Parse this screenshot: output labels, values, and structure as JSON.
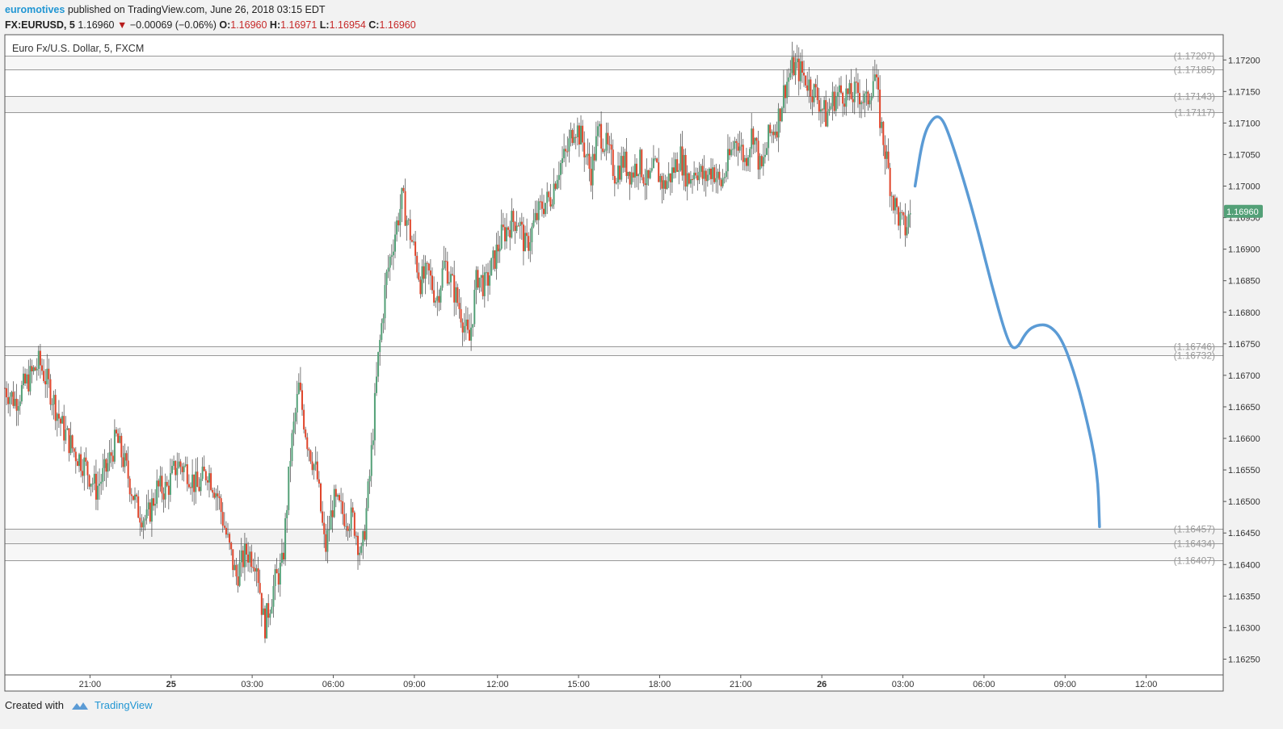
{
  "header": {
    "author": "euromotives",
    "published_text": "published on TradingView.com, June 26, 2018 03:15 EDT",
    "symbol": "FX:EURUSD, 5",
    "last_price": "1.16960",
    "change": "−0.00069 (−0.06%)",
    "o_label": "O:",
    "o_value": "1.16960",
    "h_label": "H:",
    "h_value": "1.16971",
    "l_label": "L:",
    "l_value": "1.16954",
    "c_label": "C:",
    "c_value": "1.16960"
  },
  "footer": {
    "created_with": "Created with",
    "brand": "TradingView"
  },
  "colors": {
    "up": "#53a077",
    "down": "#e0452b",
    "projection": "#5b9bd5",
    "price_tag": "#53a077",
    "level": "#999999"
  },
  "chart_data": {
    "type": "candlestick",
    "title": "Euro Fx/U.S. Dollar, 5, FXCM",
    "ylim": [
      1.16225,
      1.1724
    ],
    "y_ticks": [
      "1.17200",
      "1.17150",
      "1.17100",
      "1.17050",
      "1.17000",
      "1.16950",
      "1.16900",
      "1.16850",
      "1.16800",
      "1.16750",
      "1.16700",
      "1.16650",
      "1.16600",
      "1.16550",
      "1.16500",
      "1.16450",
      "1.16400",
      "1.16350",
      "1.16300",
      "1.16250"
    ],
    "x_ticks": [
      {
        "label": "21:00",
        "t": 11.3
      },
      {
        "label": "25",
        "t": 15.3
      },
      {
        "label": "03:00",
        "t": 19.3
      },
      {
        "label": "06:00",
        "t": 23.3
      },
      {
        "label": "09:00",
        "t": 27.3
      },
      {
        "label": "12:00",
        "t": 31.4
      },
      {
        "label": "15:00",
        "t": 35.4
      },
      {
        "label": "18:00",
        "t": 39.4
      },
      {
        "label": "21:00",
        "t": 43.4
      },
      {
        "label": "26",
        "t": 47.4
      },
      {
        "label": "03:00",
        "t": 51.4
      },
      {
        "label": "06:00",
        "t": 55.4
      },
      {
        "label": "09:00",
        "t": 59.4
      },
      {
        "label": "12:00",
        "t": 63.4
      }
    ],
    "x_range_hours": [
      7.1,
      67.2
    ],
    "last_price_tag": "1.16960",
    "levels": [
      {
        "label": "(1.17207)",
        "value": 1.17207
      },
      {
        "label": "(1.17185)",
        "value": 1.17185
      },
      {
        "label": "(1.17143)",
        "value": 1.17143
      },
      {
        "label": "(1.17117)",
        "value": 1.17117
      },
      {
        "label": "(1.16746)",
        "value": 1.16746
      },
      {
        "label": "(1.16732)",
        "value": 1.16732
      },
      {
        "label": "(1.16457)",
        "value": 1.16457
      },
      {
        "label": "(1.16434)",
        "value": 1.16434
      },
      {
        "label": "(1.16407)",
        "value": 1.16407
      }
    ],
    "price_path": [
      [
        7.1,
        1.1668
      ],
      [
        7.6,
        1.1666
      ],
      [
        8.2,
        1.1669
      ],
      [
        8.8,
        1.1672
      ],
      [
        9.3,
        1.1668
      ],
      [
        9.9,
        1.1662
      ],
      [
        10.5,
        1.1658
      ],
      [
        11.0,
        1.1656
      ],
      [
        11.6,
        1.1652
      ],
      [
        12.1,
        1.1655
      ],
      [
        12.6,
        1.166
      ],
      [
        13.1,
        1.1655
      ],
      [
        13.6,
        1.1649
      ],
      [
        14.1,
        1.1647
      ],
      [
        14.6,
        1.1652
      ],
      [
        15.1,
        1.1652
      ],
      [
        15.6,
        1.1656
      ],
      [
        16.1,
        1.1655
      ],
      [
        16.6,
        1.1652
      ],
      [
        17.1,
        1.1655
      ],
      [
        17.6,
        1.1651
      ],
      [
        18.0,
        1.1645
      ],
      [
        18.5,
        1.1638
      ],
      [
        19.0,
        1.1642
      ],
      [
        19.5,
        1.1641
      ],
      [
        19.9,
        1.163
      ],
      [
        20.4,
        1.1637
      ],
      [
        20.8,
        1.164
      ],
      [
        21.2,
        1.1658
      ],
      [
        21.6,
        1.1668
      ],
      [
        22.0,
        1.166
      ],
      [
        22.5,
        1.1654
      ],
      [
        22.9,
        1.1642
      ],
      [
        23.3,
        1.165
      ],
      [
        23.8,
        1.1648
      ],
      [
        24.3,
        1.1647
      ],
      [
        24.7,
        1.1641
      ],
      [
        25.1,
        1.1654
      ],
      [
        25.5,
        1.1672
      ],
      [
        25.9,
        1.1685
      ],
      [
        26.3,
        1.1692
      ],
      [
        26.7,
        1.1698
      ],
      [
        27.2,
        1.1691
      ],
      [
        27.6,
        1.1685
      ],
      [
        28.0,
        1.1686
      ],
      [
        28.4,
        1.1682
      ],
      [
        28.8,
        1.1688
      ],
      [
        29.2,
        1.1684
      ],
      [
        29.6,
        1.168
      ],
      [
        30.0,
        1.1675
      ],
      [
        30.4,
        1.1686
      ],
      [
        30.8,
        1.1684
      ],
      [
        31.2,
        1.1688
      ],
      [
        31.6,
        1.1692
      ],
      [
        32.0,
        1.1694
      ],
      [
        32.4,
        1.1695
      ],
      [
        32.8,
        1.169
      ],
      [
        33.2,
        1.1694
      ],
      [
        33.6,
        1.1697
      ],
      [
        34.0,
        1.1698
      ],
      [
        34.4,
        1.1703
      ],
      [
        34.8,
        1.1705
      ],
      [
        35.2,
        1.171
      ],
      [
        35.6,
        1.1707
      ],
      [
        36.0,
        1.1702
      ],
      [
        36.4,
        1.1709
      ],
      [
        36.8,
        1.1706
      ],
      [
        37.2,
        1.1702
      ],
      [
        37.6,
        1.1704
      ],
      [
        38.0,
        1.1702
      ],
      [
        38.4,
        1.1704
      ],
      [
        38.8,
        1.17
      ],
      [
        39.2,
        1.1703
      ],
      [
        39.6,
        1.17
      ],
      [
        40.0,
        1.1702
      ],
      [
        40.4,
        1.1705
      ],
      [
        40.8,
        1.1701
      ],
      [
        41.2,
        1.1703
      ],
      [
        41.6,
        1.1701
      ],
      [
        42.0,
        1.1703
      ],
      [
        42.4,
        1.17
      ],
      [
        42.8,
        1.1704
      ],
      [
        43.2,
        1.1708
      ],
      [
        43.6,
        1.1704
      ],
      [
        44.0,
        1.1709
      ],
      [
        44.4,
        1.1702
      ],
      [
        44.8,
        1.1708
      ],
      [
        45.2,
        1.171
      ],
      [
        45.6,
        1.1716
      ],
      [
        46.0,
        1.1719
      ],
      [
        46.4,
        1.1718
      ],
      [
        46.8,
        1.1716
      ],
      [
        47.2,
        1.1714
      ],
      [
        47.6,
        1.1711
      ],
      [
        48.0,
        1.1714
      ],
      [
        48.4,
        1.1715
      ],
      [
        48.8,
        1.1714
      ],
      [
        49.2,
        1.1715
      ],
      [
        49.6,
        1.1713
      ],
      [
        50.0,
        1.1718
      ],
      [
        50.3,
        1.171
      ],
      [
        50.6,
        1.1704
      ],
      [
        50.9,
        1.1698
      ],
      [
        51.2,
        1.1695
      ],
      [
        51.5,
        1.1693
      ],
      [
        51.8,
        1.1696
      ]
    ],
    "projection": [
      [
        52.0,
        1.17
      ],
      [
        52.4,
        1.1708
      ],
      [
        52.9,
        1.1711
      ],
      [
        53.3,
        1.1711
      ],
      [
        53.7,
        1.1708
      ],
      [
        54.4,
        1.1701
      ],
      [
        55.1,
        1.1693
      ],
      [
        55.8,
        1.1684
      ],
      [
        56.6,
        1.1675
      ],
      [
        57.0,
        1.1674
      ],
      [
        57.5,
        1.1677
      ],
      [
        58.0,
        1.1678
      ],
      [
        58.6,
        1.1678
      ],
      [
        59.2,
        1.1676
      ],
      [
        59.8,
        1.1671
      ],
      [
        60.4,
        1.1664
      ],
      [
        61.0,
        1.1655
      ],
      [
        61.1,
        1.1646
      ]
    ]
  }
}
